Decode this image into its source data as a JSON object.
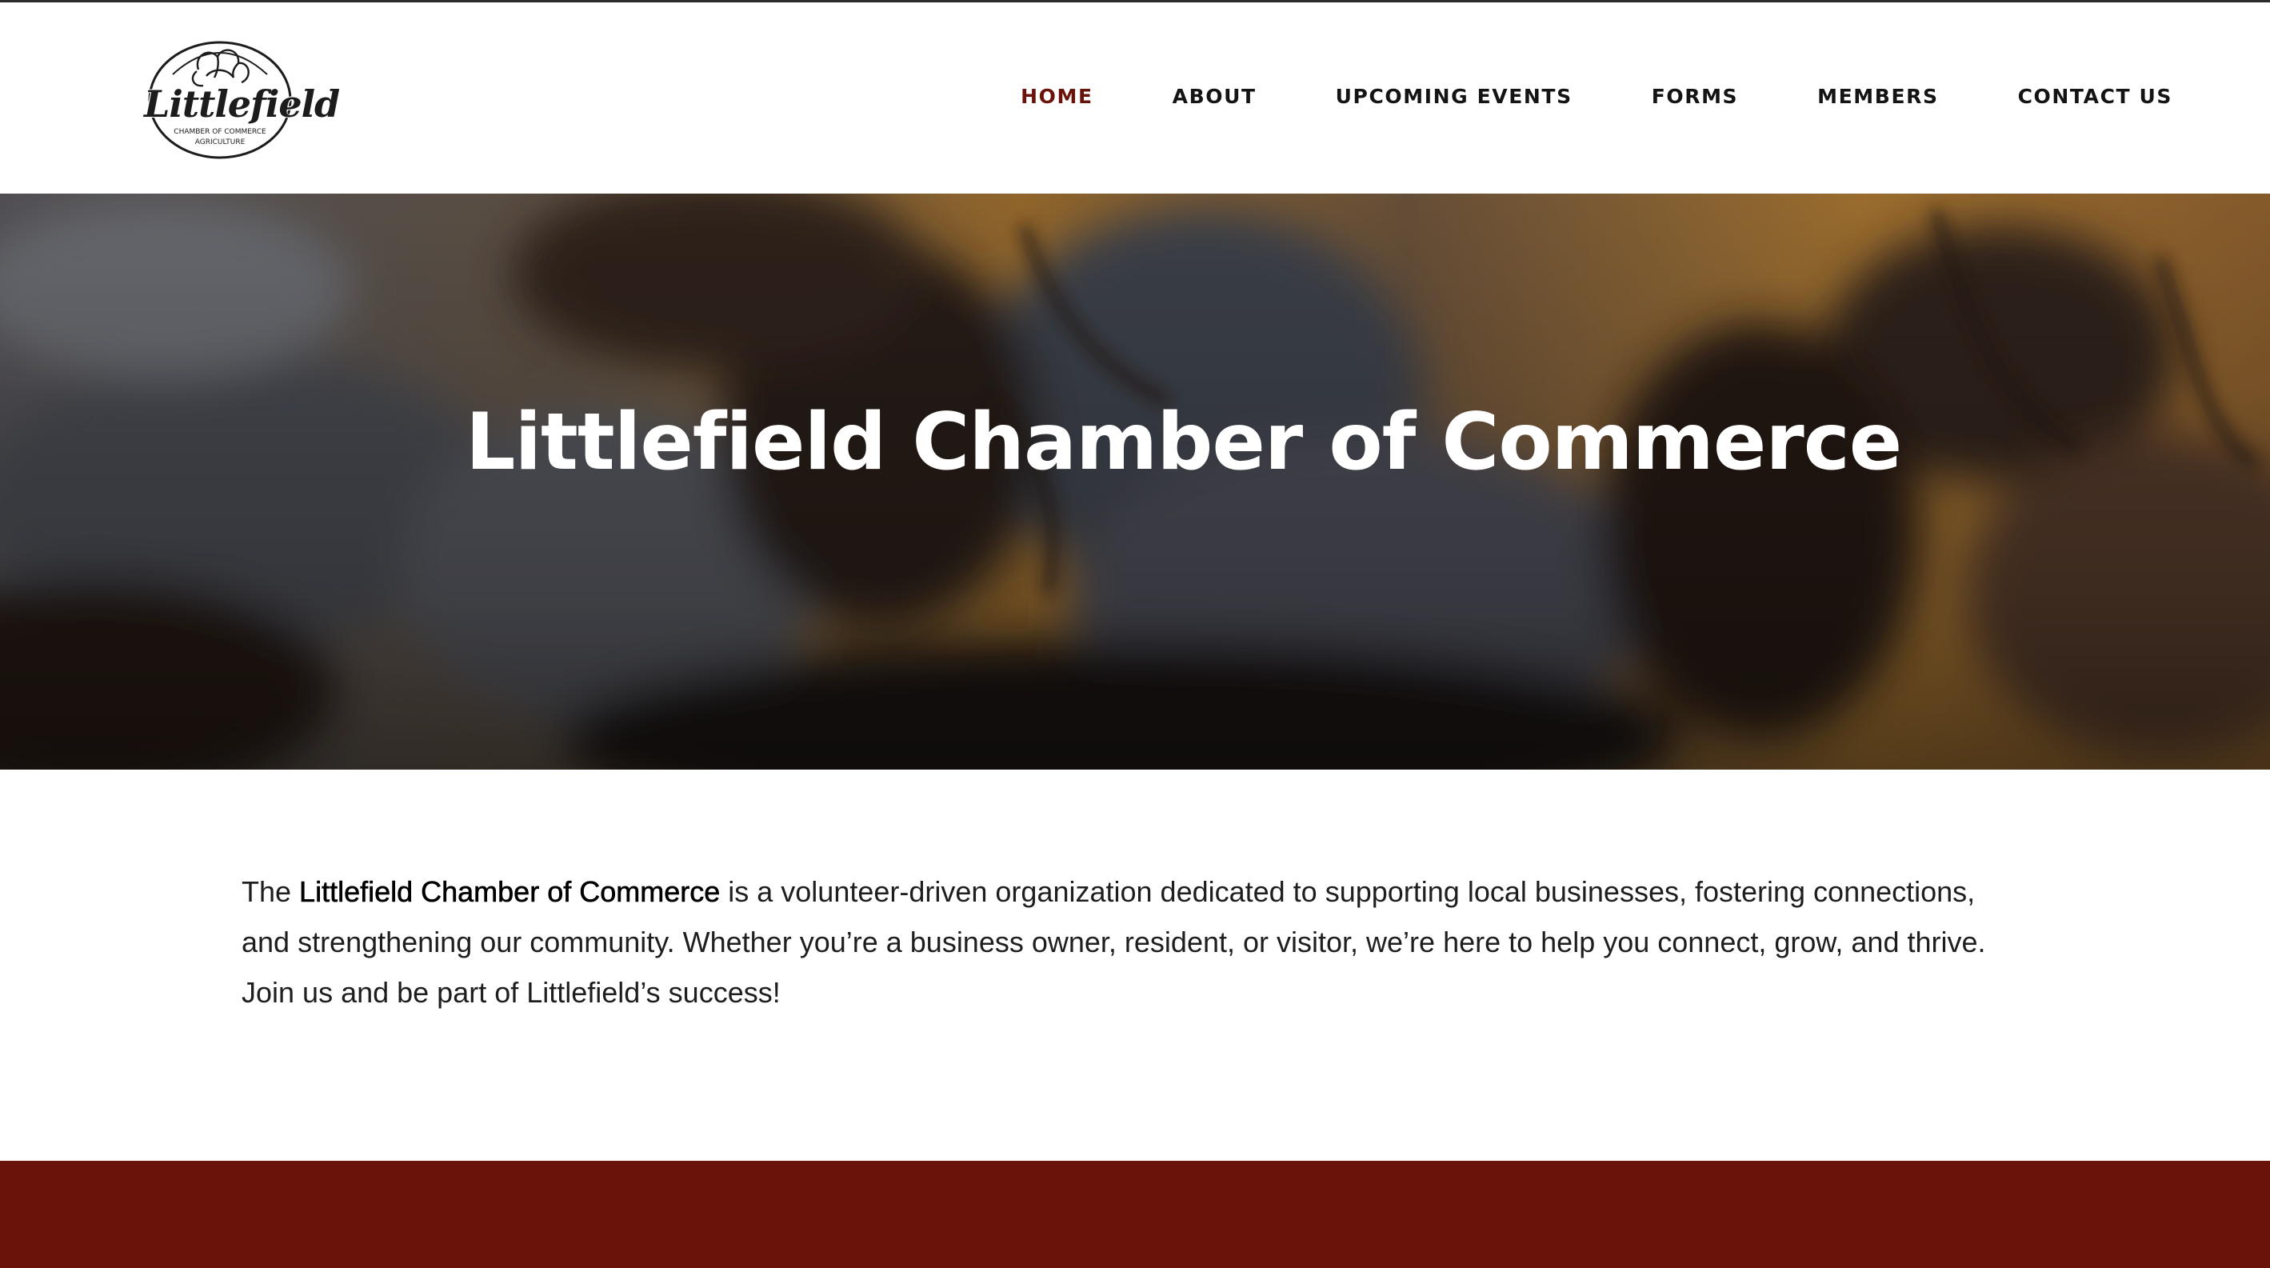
{
  "header": {
    "logo": {
      "name": "Littlefield",
      "tagline_line1": "CHAMBER OF COMMERCE",
      "tagline_line2": "AGRICULTURE"
    },
    "nav": [
      {
        "label": "HOME",
        "active": true
      },
      {
        "label": "ABOUT",
        "active": false
      },
      {
        "label": "UPCOMING EVENTS",
        "active": false
      },
      {
        "label": "FORMS",
        "active": false
      },
      {
        "label": "MEMBERS",
        "active": false
      },
      {
        "label": "CONTACT US",
        "active": false
      }
    ]
  },
  "hero": {
    "title": "Littlefield Chamber of Commerce"
  },
  "intro": {
    "lead": "The ",
    "org_name": "Littlefield Chamber of Commerce",
    "body": " is a volunteer-driven organization dedicated to supporting local businesses, fostering connections, and strengthening our community. Whether you’re a business owner, resident, or visitor, we’re here to help you connect, grow, and thrive. Join us and be part of Littlefield’s success!"
  },
  "colors": {
    "accent": "#6a130a",
    "nav_text": "#141414",
    "hero_text": "#ffffff"
  }
}
